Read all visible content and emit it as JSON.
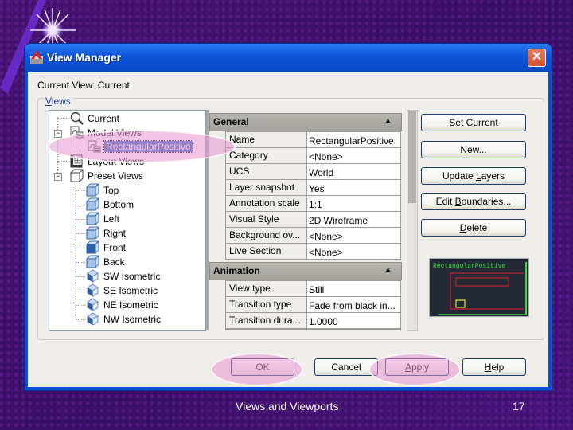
{
  "window": {
    "title": "View Manager",
    "close_glyph": "✕"
  },
  "current_view": {
    "text": "Current View: Current"
  },
  "views_group": {
    "label_prefix": "",
    "label_mnemonic": "V",
    "label_rest": "iews"
  },
  "tree": {
    "items": [
      {
        "label": "Current",
        "icon": "magnifier-icon"
      },
      {
        "label": "Model Views",
        "icon": "model-view-icon",
        "expanded": true
      },
      {
        "label": "RectangularPositive",
        "icon": "model-view-icon",
        "selected": true
      },
      {
        "label": "Layout Views",
        "icon": "layout-view-icon"
      },
      {
        "label": "Preset Views",
        "icon": "cube-icon",
        "expanded": true
      },
      {
        "label": "Top",
        "icon": "cube-top-icon"
      },
      {
        "label": "Bottom",
        "icon": "cube-bottom-icon"
      },
      {
        "label": "Left",
        "icon": "cube-left-icon"
      },
      {
        "label": "Right",
        "icon": "cube-right-icon"
      },
      {
        "label": "Front",
        "icon": "cube-front-icon"
      },
      {
        "label": "Back",
        "icon": "cube-back-icon"
      },
      {
        "label": "SW Isometric",
        "icon": "iso-sw-icon"
      },
      {
        "label": "SE Isometric",
        "icon": "iso-se-icon"
      },
      {
        "label": "NE Isometric",
        "icon": "iso-ne-icon"
      },
      {
        "label": "NW Isometric",
        "icon": "iso-nw-icon"
      }
    ]
  },
  "properties": {
    "general": {
      "label": "General",
      "rows": [
        {
          "name": "Name",
          "value": "RectangularPositive"
        },
        {
          "name": "Category",
          "value": "<None>"
        },
        {
          "name": "UCS",
          "value": "World"
        },
        {
          "name": "Layer snapshot",
          "value": "Yes"
        },
        {
          "name": "Annotation scale",
          "value": "1:1"
        },
        {
          "name": "Visual Style",
          "value": "2D Wireframe"
        },
        {
          "name": "Background ov...",
          "value": "<None>"
        },
        {
          "name": "Live Section",
          "value": "<None>"
        }
      ]
    },
    "animation": {
      "label": "Animation",
      "rows": [
        {
          "name": "View type",
          "value": "Still"
        },
        {
          "name": "Transition type",
          "value": "Fade from black in..."
        },
        {
          "name": "Transition dura...",
          "value": "1.0000"
        }
      ]
    },
    "collapse_glyph": "▲"
  },
  "side_buttons": [
    {
      "pre": "Set ",
      "mn": "C",
      "post": "urrent"
    },
    {
      "pre": "",
      "mn": "N",
      "post": "ew..."
    },
    {
      "pre": "Update ",
      "mn": "L",
      "post": "ayers"
    },
    {
      "pre": "Edit ",
      "mn": "B",
      "post": "oundaries..."
    },
    {
      "pre": "",
      "mn": "D",
      "post": "elete"
    }
  ],
  "preview": {
    "caption": "RectangularPositive",
    "colors": {
      "background": "#232a35",
      "caption": "#33dd33",
      "outer_rect": "#c02030",
      "inner_rect": "#c02030",
      "small_rect": "#e6e640",
      "border": "#33dd33"
    }
  },
  "bottom_buttons": {
    "ok": {
      "pre": "OK",
      "mn": "",
      "post": ""
    },
    "cancel": {
      "pre": "Cancel",
      "mn": "",
      "post": ""
    },
    "apply": {
      "pre": "",
      "mn": "A",
      "post": "pply"
    },
    "help": {
      "pre": "",
      "mn": "H",
      "post": "elp"
    }
  },
  "slide": {
    "footer": "Views and Viewports",
    "page_number": "17"
  },
  "colors": {
    "titlebar": "#0f56dc",
    "selection": "#3169c6",
    "highlight": "#e896d2",
    "slide_background": "#4a1478"
  }
}
